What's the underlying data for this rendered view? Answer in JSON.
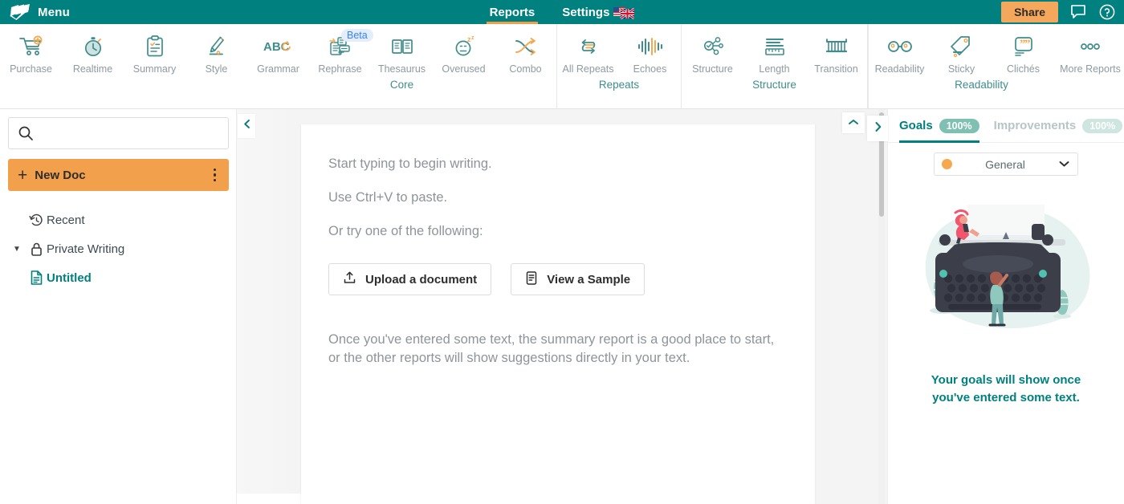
{
  "topbar": {
    "brand_label": "Menu",
    "brand_icon": "prowritingaid-logo-icon",
    "nav": [
      {
        "label": "Reports",
        "active": true,
        "icon": null
      },
      {
        "label": "Settings",
        "active": false,
        "icon": "us-uk-flags-icon"
      }
    ],
    "share_label": "Share",
    "chat_icon": "chat-bubble-icon",
    "help_icon": "question-circle-icon",
    "bg_color": "#00807f",
    "accent_color": "#f0a04b"
  },
  "ribbon": {
    "groups": [
      {
        "label": "",
        "items": [
          {
            "label": "Purchase",
            "icon": "shopping-cart-plus-icon"
          },
          {
            "label": "Realtime",
            "icon": "stopwatch-icon"
          },
          {
            "label": "Summary",
            "icon": "clipboard-check-icon"
          },
          {
            "label": "Style",
            "icon": "fountain-pen-icon"
          }
        ]
      },
      {
        "label": "Core",
        "items": [
          {
            "label": "Grammar",
            "icon": "abc-check-icon"
          },
          {
            "label": "Rephrase",
            "icon": "rephrase-cards-icon",
            "badge": "Beta"
          },
          {
            "label": "Thesaurus",
            "icon": "open-book-icon"
          },
          {
            "label": "Overused",
            "icon": "sleepy-face-icon"
          },
          {
            "label": "Combo",
            "icon": "crossing-arrows-icon"
          }
        ]
      },
      {
        "label": "Repeats",
        "items": [
          {
            "label": "All Repeats",
            "icon": "repeat-arrows-icon"
          },
          {
            "label": "Echoes",
            "icon": "waveform-icon"
          }
        ]
      },
      {
        "label": "Structure",
        "items": [
          {
            "label": "Structure",
            "icon": "node-network-icon"
          },
          {
            "label": "Length",
            "icon": "ruler-lines-icon"
          },
          {
            "label": "Transition",
            "icon": "bridge-icon"
          }
        ]
      },
      {
        "label": "Readability",
        "items": [
          {
            "label": "Readability",
            "icon": "glasses-icon"
          },
          {
            "label": "Sticky",
            "icon": "sticky-tag-icon"
          },
          {
            "label": "Clichés",
            "icon": "quote-bubble-icon"
          },
          {
            "label": "More Reports",
            "icon": "ellipsis-icon"
          }
        ]
      }
    ]
  },
  "sidebar": {
    "search_placeholder": "",
    "search_value": "",
    "search_icon": "search-icon",
    "new_doc_label": "New Doc",
    "new_doc_kebab_icon": "kebab-menu-icon",
    "tree": [
      {
        "label": "Recent",
        "icon": "history-clock-icon",
        "level": 0,
        "twisty": "",
        "selected": false
      },
      {
        "label": "Private Writing",
        "icon": "lock-icon",
        "level": 0,
        "twisty": "▼",
        "selected": false
      },
      {
        "label": "Untitled",
        "icon": "document-icon",
        "level": 1,
        "twisty": "",
        "selected": true
      }
    ]
  },
  "editor": {
    "collapse_left_icon": "chevron-left-icon",
    "collapse_up_icon": "chevron-up-icon",
    "collapse_right_icon": "chevron-right-icon",
    "hints": [
      "Start typing to begin writing.",
      "Use Ctrl+V to paste.",
      "Or try one of the following:"
    ],
    "buttons": [
      {
        "label": "Upload a document",
        "icon": "upload-icon"
      },
      {
        "label": "View a Sample",
        "icon": "document-lines-icon"
      }
    ],
    "paragraph": "Once you've entered some text, the summary report is a good place to start, or the other reports will show suggestions directly in your text."
  },
  "goals_panel": {
    "tabs": [
      {
        "label": "Goals",
        "pct": "100%",
        "active": true
      },
      {
        "label": "Improvements",
        "pct": "100%",
        "active": false
      }
    ],
    "selector": {
      "label": "General",
      "dot_color": "#f5a84e",
      "chevron_icon": "chevron-down-icon"
    },
    "illustration": "typewriter-illustration",
    "empty_message": "Your goals will show once you've entered some text."
  }
}
